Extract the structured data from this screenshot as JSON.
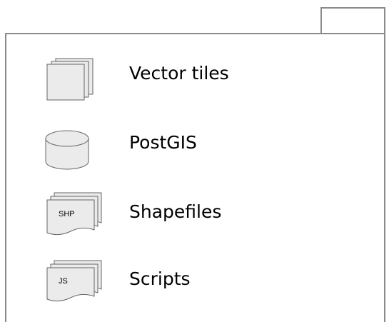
{
  "diagram": {
    "colors": {
      "frame_stroke": "#8a8a8a",
      "icon_fill": "#ebebeb",
      "icon_stroke": "#666666",
      "background": "#ffffff",
      "text": "#000000"
    },
    "items": [
      {
        "label": "Vector tiles",
        "icon": "stacked-pages-icon"
      },
      {
        "label": "PostGIS",
        "icon": "database-cylinder-icon"
      },
      {
        "label": "Shapefiles",
        "icon": "multi-document-icon",
        "icon_text": "SHP"
      },
      {
        "label": "Scripts",
        "icon": "multi-document-icon",
        "icon_text": "JS"
      }
    ]
  }
}
